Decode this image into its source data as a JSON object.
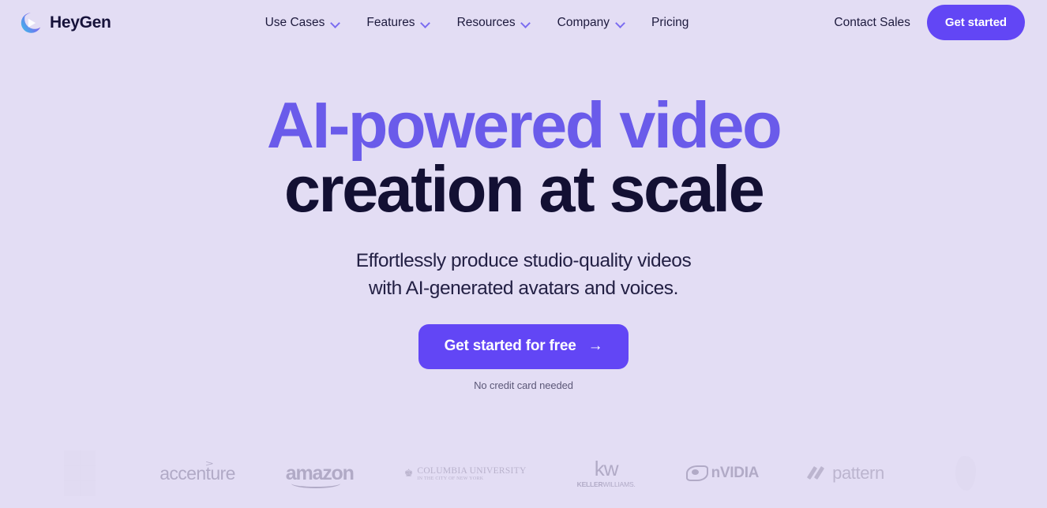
{
  "brand": {
    "name": "HeyGen",
    "logo_icon": "heygen-play-swoosh-icon"
  },
  "nav": {
    "items": [
      {
        "label": "Use Cases",
        "has_dropdown": true
      },
      {
        "label": "Features",
        "has_dropdown": true
      },
      {
        "label": "Resources",
        "has_dropdown": true
      },
      {
        "label": "Company",
        "has_dropdown": true
      },
      {
        "label": "Pricing",
        "has_dropdown": false
      }
    ]
  },
  "header_actions": {
    "contact_sales": "Contact Sales",
    "get_started": "Get started"
  },
  "hero": {
    "title_line1": "AI-powered video",
    "title_line2": "creation at scale",
    "subtitle_line1": "Effortlessly produce studio-quality videos",
    "subtitle_line2": "with AI-generated avatars and voices.",
    "cta_label": "Get started for free",
    "cta_arrow": "→",
    "cta_note": "No credit card needed"
  },
  "logos": {
    "items": [
      {
        "name": "accenture",
        "label": "accenture"
      },
      {
        "name": "amazon",
        "label": "amazon"
      },
      {
        "name": "columbia-university",
        "label": "COLUMBIA UNIVERSITY",
        "sublabel": "IN THE CITY OF NEW YORK"
      },
      {
        "name": "keller-williams",
        "label": "kw",
        "sublabel_bold": "KELLER",
        "sublabel_light": "WILLIAMS."
      },
      {
        "name": "nvidia",
        "label": "nVIDIA"
      },
      {
        "name": "pattern",
        "label": "pattern"
      }
    ]
  },
  "colors": {
    "background": "#e3ddf4",
    "accent_purple": "#6246f5",
    "heading_purple": "#6a5bea",
    "heading_dark": "#131033",
    "logo_gray": "#a9a2bf"
  }
}
